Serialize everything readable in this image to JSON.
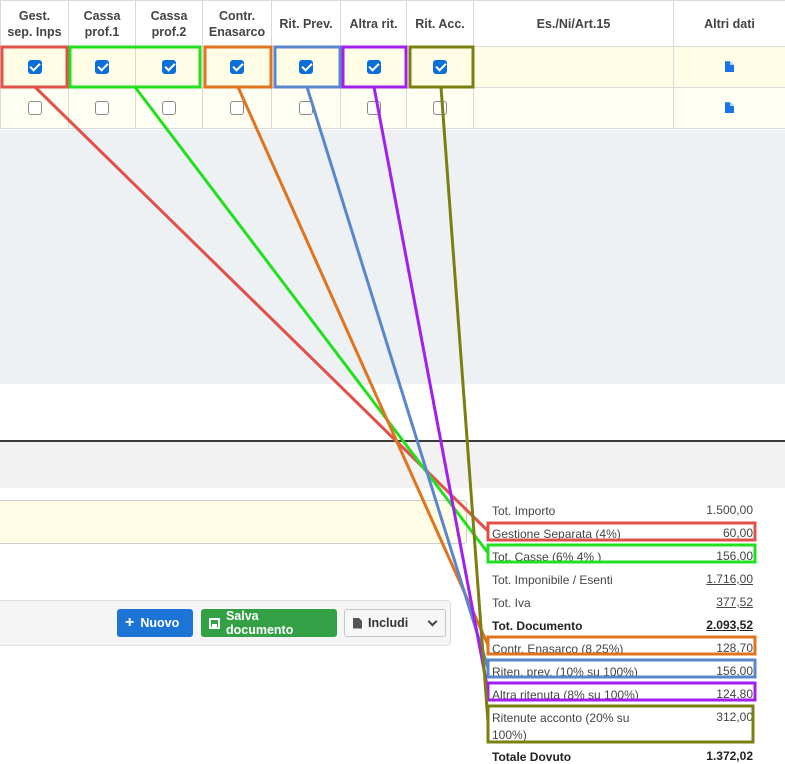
{
  "columns": [
    {
      "label": "Gest.\nsep. Inps"
    },
    {
      "label": "Cassa\nprof.1"
    },
    {
      "label": "Cassa\nprof.2"
    },
    {
      "label": "Contr.\nEnasarco"
    },
    {
      "label": "Rit. Prev."
    },
    {
      "label": "Altra rit."
    },
    {
      "label": "Rit. Acc."
    },
    {
      "label": "Es./Ni/Art.15"
    },
    {
      "label": "Altri dati"
    }
  ],
  "rows": [
    {
      "checks": [
        true,
        true,
        true,
        true,
        true,
        true,
        true
      ],
      "icon": "document-icon"
    },
    {
      "checks": [
        false,
        false,
        false,
        false,
        false,
        false,
        false
      ],
      "icon": "document-icon"
    }
  ],
  "buttons": {
    "new_label": "Nuovo",
    "save_label": "Salva documento",
    "include_label": "Includi"
  },
  "totals": [
    {
      "label": "Tot. Importo",
      "value": "1.500,00"
    },
    {
      "label": "Gestione Separata (4%)",
      "value": "60,00"
    },
    {
      "label": "Tot. Casse (6%  4% )",
      "value": "156,00"
    },
    {
      "label": "Tot. Imponibile / Esenti",
      "value": "1.716,00"
    },
    {
      "label": "Tot. Iva",
      "value": "377,52"
    },
    {
      "label": "Tot. Documento",
      "value": "2.093,52"
    },
    {
      "label": "Contr. Enasarco (8.25%)",
      "value": "128,70"
    },
    {
      "label": "Riten. prev. (10% su 100%)",
      "value": "156,00"
    },
    {
      "label": "Altra ritenuta  (8% su 100%)",
      "value": "124,80"
    },
    {
      "label": "Ritenute acconto (20% su\n100%)",
      "value": "312,00"
    },
    {
      "label": "Totale Dovuto",
      "value": "1.372,02"
    }
  ],
  "highlight_colors": {
    "gest_sep": "#e2504a",
    "casse": "#22e01f",
    "enasarco": "#e0741e",
    "rit_prev": "#5a87cc",
    "altra_rit": "#a21ff0",
    "rit_acc": "#7a7f10"
  },
  "icons": {
    "doc": "document-icon",
    "new": "plus-icon",
    "save": "floppy-disk-icon",
    "include": "file-icon",
    "dropdown": "chevron-down-icon"
  }
}
